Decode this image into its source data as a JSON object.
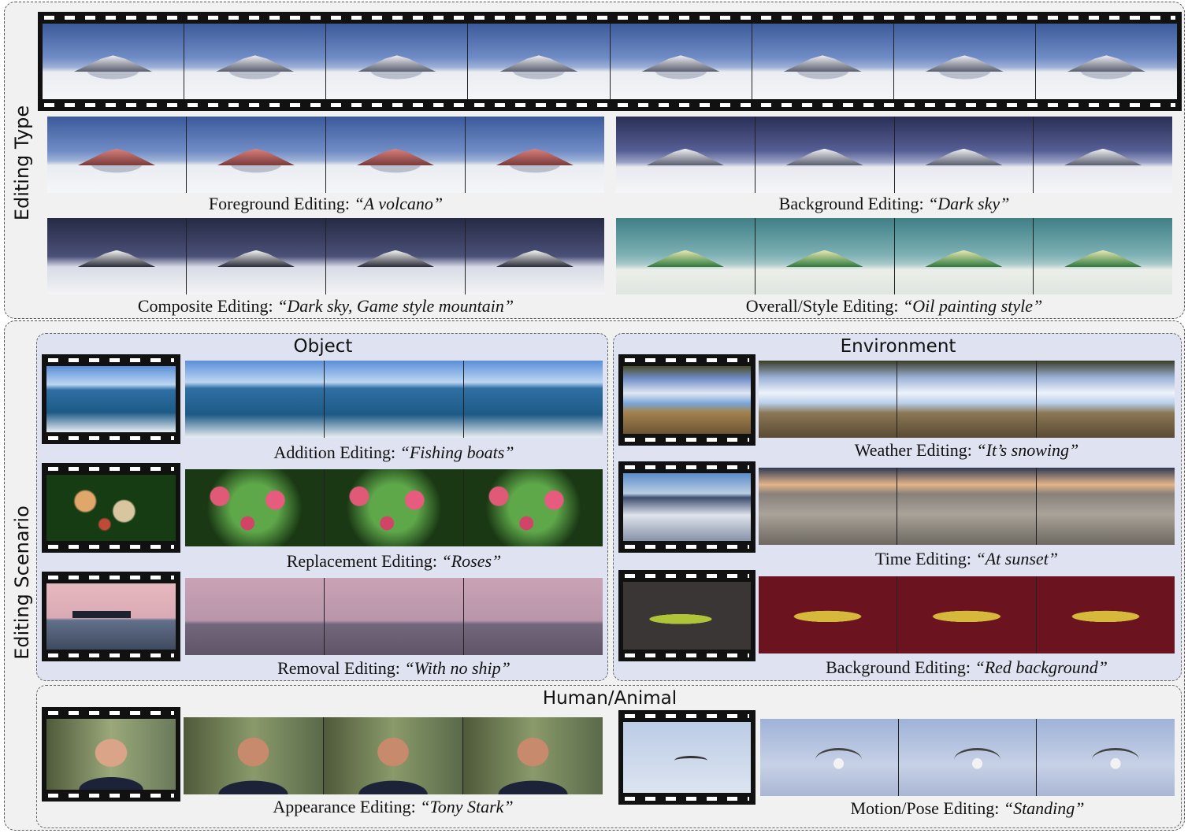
{
  "editing_type": {
    "section_label": "Editing Type",
    "captions": {
      "foreground": {
        "prefix": "Foreground Editing: ",
        "prompt": "“A volcano”"
      },
      "background": {
        "prefix": "Background Editing: ",
        "prompt": "“Dark sky”"
      },
      "composite": {
        "prefix": "Composite Editing: ",
        "prompt": "“Dark sky, Game style mountain”"
      },
      "overall": {
        "prefix": "Overall/Style Editing: ",
        "prompt": "“Oil painting style”"
      }
    }
  },
  "editing_scenario": {
    "section_label": "Editing Scenario",
    "object": {
      "title": "Object",
      "addition": {
        "prefix": "Addition Editing: ",
        "prompt": "“Fishing boats”"
      },
      "replacement": {
        "prefix": "Replacement Editing: ",
        "prompt": "“Roses”"
      },
      "removal": {
        "prefix": "Removal Editing: ",
        "prompt": "“With no ship”"
      }
    },
    "environment": {
      "title": "Environment",
      "weather": {
        "prefix": "Weather Editing: ",
        "prompt": "“It’s snowing”"
      },
      "time": {
        "prefix": "Time Editing: ",
        "prompt": "“At sunset”"
      },
      "background": {
        "prefix": "Background Editing: ",
        "prompt": "“Red background”"
      }
    },
    "human_animal": {
      "title": "Human/Animal",
      "appearance": {
        "prefix": "Appearance Editing: ",
        "prompt": "“Tony Stark”"
      },
      "motion": {
        "prefix": "Motion/Pose Editing: ",
        "prompt": "“Standing”"
      }
    }
  },
  "colors": {
    "panel_bg": "#f1f1f1",
    "subpanel_bg": "#dfe3f1",
    "film": "#111111"
  }
}
